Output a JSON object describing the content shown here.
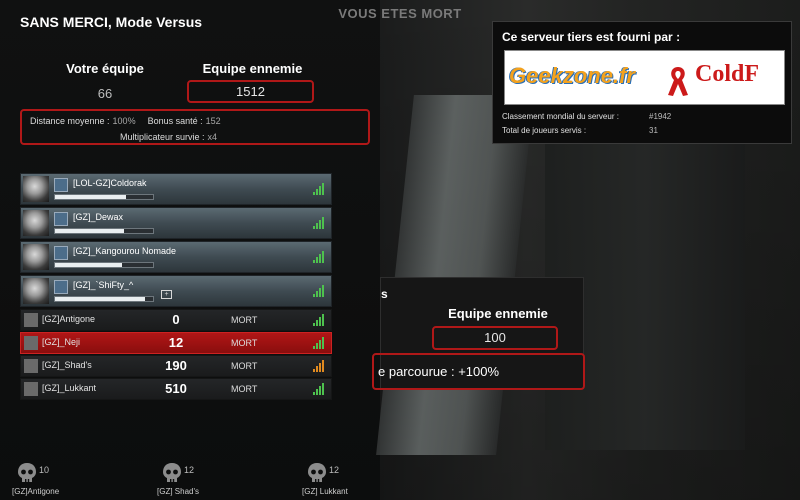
{
  "header": {
    "mode_title": "SANS MERCI, Mode Versus",
    "dead_banner": "VOUS ETES MORT"
  },
  "score": {
    "our_label": "Votre équipe",
    "our_value": "66",
    "enemy_label": "Equipe ennemie",
    "enemy_value": "1512"
  },
  "stats": {
    "distance_label": "Distance moyenne :",
    "distance_value": "100%",
    "bonus_label": "Bonus santé :",
    "bonus_value": "152",
    "mult_label": "Multiplicateur survie :",
    "mult_value": "x4"
  },
  "survivors": [
    {
      "name": "[LOL-GZ]Coldorak",
      "health": 0.72,
      "medkit": false
    },
    {
      "name": "[GZ]_Dewax",
      "health": 0.7,
      "medkit": false
    },
    {
      "name": "[GZ]_Kangourou Nomade",
      "health": 0.68,
      "medkit": false
    },
    {
      "name": "[GZ]_`ShiFty_^",
      "health": 0.92,
      "medkit": true
    }
  ],
  "infected": [
    {
      "name": "[GZ]Antigone",
      "score": "0",
      "status": "MORT",
      "highlight": false,
      "signal": "green"
    },
    {
      "name": "[GZ]_Neji",
      "score": "12",
      "status": "MORT",
      "highlight": true,
      "signal": "green"
    },
    {
      "name": "[GZ]_Shad's",
      "score": "190",
      "status": "MORT",
      "highlight": false,
      "signal": "orange"
    },
    {
      "name": "[GZ]_Lukkant",
      "score": "510",
      "status": "MORT",
      "highlight": false,
      "signal": "green"
    }
  ],
  "server": {
    "title": "Ce serveur tiers est fourni par :",
    "logo_left": "Geekzone.fr",
    "logo_right": "ColdF",
    "rank_label": "Classement mondial du serveur :",
    "rank_value": "#1942",
    "players_label": "Total de joueurs servis :",
    "players_value": "31"
  },
  "right_card": {
    "title_fragment": "s",
    "enemy_label": "Equipe ennemie",
    "enemy_value": "100",
    "stats_text": "e parcourue : +100%"
  },
  "kills": [
    {
      "count": "10",
      "name": "[GZ]Antigone"
    },
    {
      "count": "12",
      "name": "[GZ] Shad's"
    },
    {
      "count": "12",
      "name": "[GZ] Lukkant"
    }
  ],
  "colors": {
    "accent_red": "#b01818",
    "signal_green": "#4ec24e",
    "signal_orange": "#e08a20",
    "logo_orange": "#f4a21e",
    "logo_red": "#cc1a1a"
  }
}
